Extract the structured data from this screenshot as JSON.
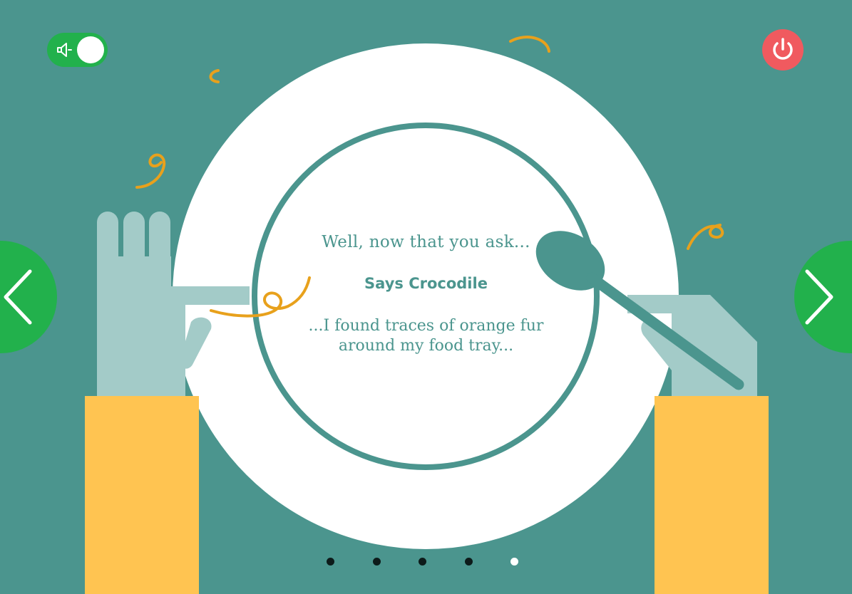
{
  "dialogue": {
    "intro": "Well, now that you ask...",
    "speaker": "Says Crocodile",
    "quote_line1": "...I found traces of orange fur",
    "quote_line2": "around my food tray..."
  },
  "controls": {
    "sound_icon": "speaker-icon",
    "sound_on": true,
    "power_icon": "power-icon",
    "prev_icon": "chevron-left-icon",
    "next_icon": "chevron-right-icon"
  },
  "pagination": {
    "total": 5,
    "active_index": 4
  },
  "colors": {
    "background": "#4b958e",
    "plate": "#ffffff",
    "hand": "#a3cbc8",
    "sleeve": "#ffc451",
    "toggle_green": "#22b14c",
    "power_red": "#f05a5f",
    "fur_orange": "#e8a11c"
  }
}
